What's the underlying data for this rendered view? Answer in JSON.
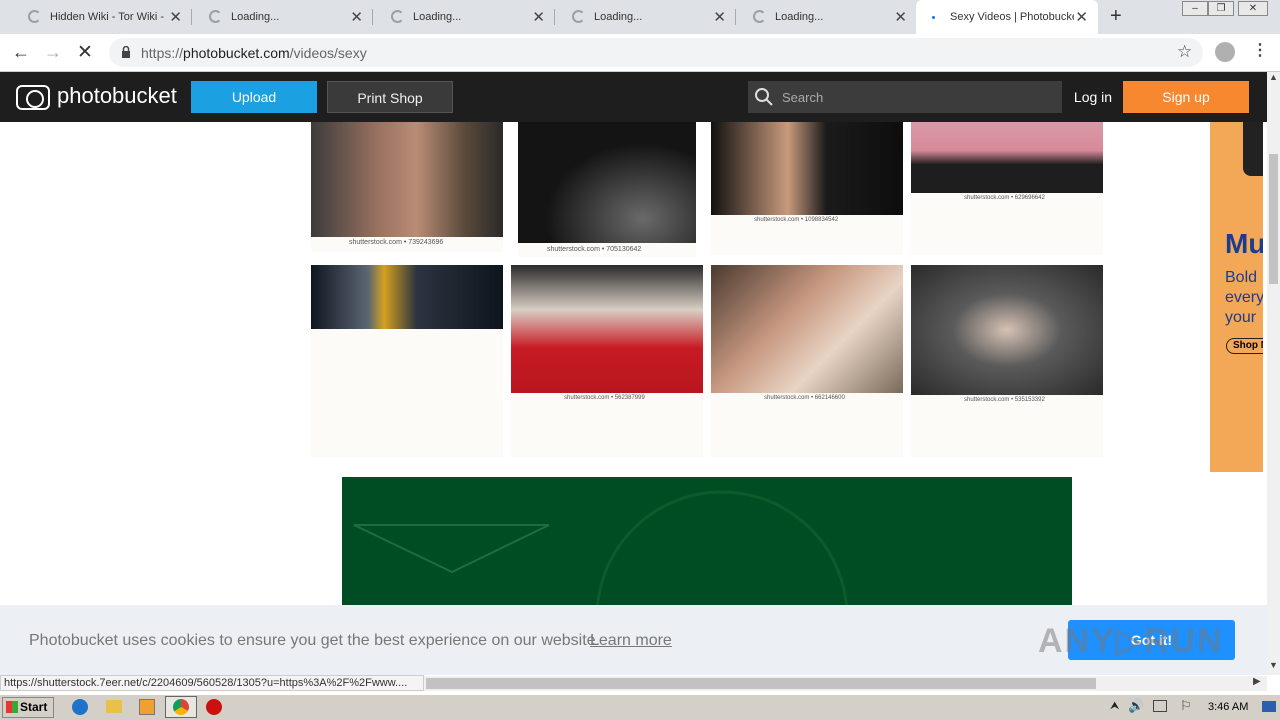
{
  "browser": {
    "tabs": [
      {
        "title": "Hidden Wiki - Tor Wiki - Deep Web",
        "loading": true
      },
      {
        "title": "Loading...",
        "loading": true
      },
      {
        "title": "Loading...",
        "loading": true
      },
      {
        "title": "Loading...",
        "loading": true
      },
      {
        "title": "Loading...",
        "loading": true
      },
      {
        "title": "Sexy Videos | Photobucket",
        "loading": true,
        "active": true
      }
    ],
    "url_prefix": "https://",
    "url_host": "photobucket.com",
    "url_path": "/videos/sexy"
  },
  "header": {
    "logo": "photobucket",
    "upload": "Upload",
    "print_shop": "Print Shop",
    "search_placeholder": "Search",
    "login": "Log in",
    "signup": "Sign up"
  },
  "gallery": {
    "captions": [
      "shutterstock.com • 739243696",
      "shutterstock.com • 705130642",
      "shutterstock.com • 1098834542",
      "shutterstock.com • 629696642",
      "shutterstock.com • 562387999",
      "shutterstock.com • 662146600",
      "shutterstock.com • 535153392"
    ]
  },
  "ad": {
    "text": "Mu\nBold\nevery\nyour",
    "shop": "Shop N"
  },
  "cookie": {
    "message": "Photobucket uses cookies to ensure you get the best experience on our website.",
    "learn_more": "Learn more",
    "got_it": "Got it!"
  },
  "status_url": "https://shutterstock.7eer.net/c/2204609/560528/1305?u=https%3A%2F%2Fwww....",
  "taskbar": {
    "start": "Start",
    "clock": "3:46 AM"
  },
  "colors": {
    "upload": "#1ba0e2",
    "signup": "#f7882f",
    "header_bg": "#1e1e1e",
    "ad_green": "#004d23"
  }
}
